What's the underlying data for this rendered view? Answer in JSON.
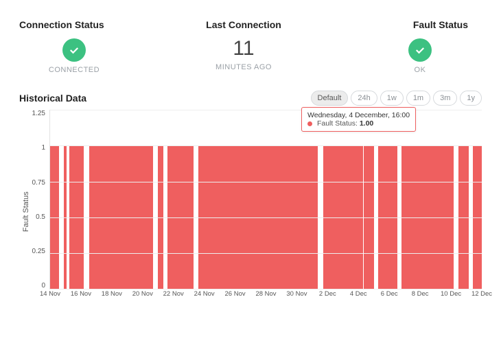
{
  "status": {
    "connection": {
      "title": "Connection Status",
      "sub": "CONNECTED",
      "icon": "check"
    },
    "last": {
      "title": "Last Connection",
      "value": "11",
      "sub": "MINUTES AGO"
    },
    "fault": {
      "title": "Fault Status",
      "sub": "OK",
      "icon": "check"
    }
  },
  "historical": {
    "title": "Historical Data",
    "ranges": [
      {
        "label": "Default",
        "active": true
      },
      {
        "label": "24h",
        "active": false
      },
      {
        "label": "1w",
        "active": false
      },
      {
        "label": "1m",
        "active": false
      },
      {
        "label": "3m",
        "active": false
      },
      {
        "label": "1y",
        "active": false
      }
    ],
    "tooltip": {
      "date": "Wednesday, 4 December, 16:00",
      "series": "Fault Status:",
      "value": "1.00",
      "x_pct": 72.5
    }
  },
  "chart_data": {
    "type": "bar",
    "ylabel": "Fault  Status",
    "ylim": [
      0,
      1.25
    ],
    "y_ticks": [
      0,
      0.25,
      0.5,
      0.75,
      1,
      1.25
    ],
    "x_range_days": [
      "14 Nov",
      "12 Dec"
    ],
    "x_ticks": [
      "14 Nov",
      "16 Nov",
      "18 Nov",
      "20 Nov",
      "22 Nov",
      "24 Nov",
      "26 Nov",
      "28 Nov",
      "30 Nov",
      "2 Dec",
      "4 Dec",
      "6 Dec",
      "8 Dec",
      "10 Dec",
      "12 Dec"
    ],
    "fault_segments_pct": [
      {
        "start": 0.0,
        "end": 2.0
      },
      {
        "start": 3.2,
        "end": 3.8
      },
      {
        "start": 4.5,
        "end": 7.8
      },
      {
        "start": 9.0,
        "end": 23.9
      },
      {
        "start": 25.0,
        "end": 26.3
      },
      {
        "start": 27.2,
        "end": 33.2
      },
      {
        "start": 34.3,
        "end": 62.0
      },
      {
        "start": 63.2,
        "end": 75.0
      },
      {
        "start": 76.0,
        "end": 80.4
      },
      {
        "start": 81.4,
        "end": 93.5
      },
      {
        "start": 94.6,
        "end": 97.0
      },
      {
        "start": 98.0,
        "end": 100.0
      }
    ],
    "value_when_fault": 1.0,
    "series_name": "Fault Status",
    "tooltip_sample": {
      "x": "4 Dec 16:00",
      "y": 1.0
    }
  }
}
